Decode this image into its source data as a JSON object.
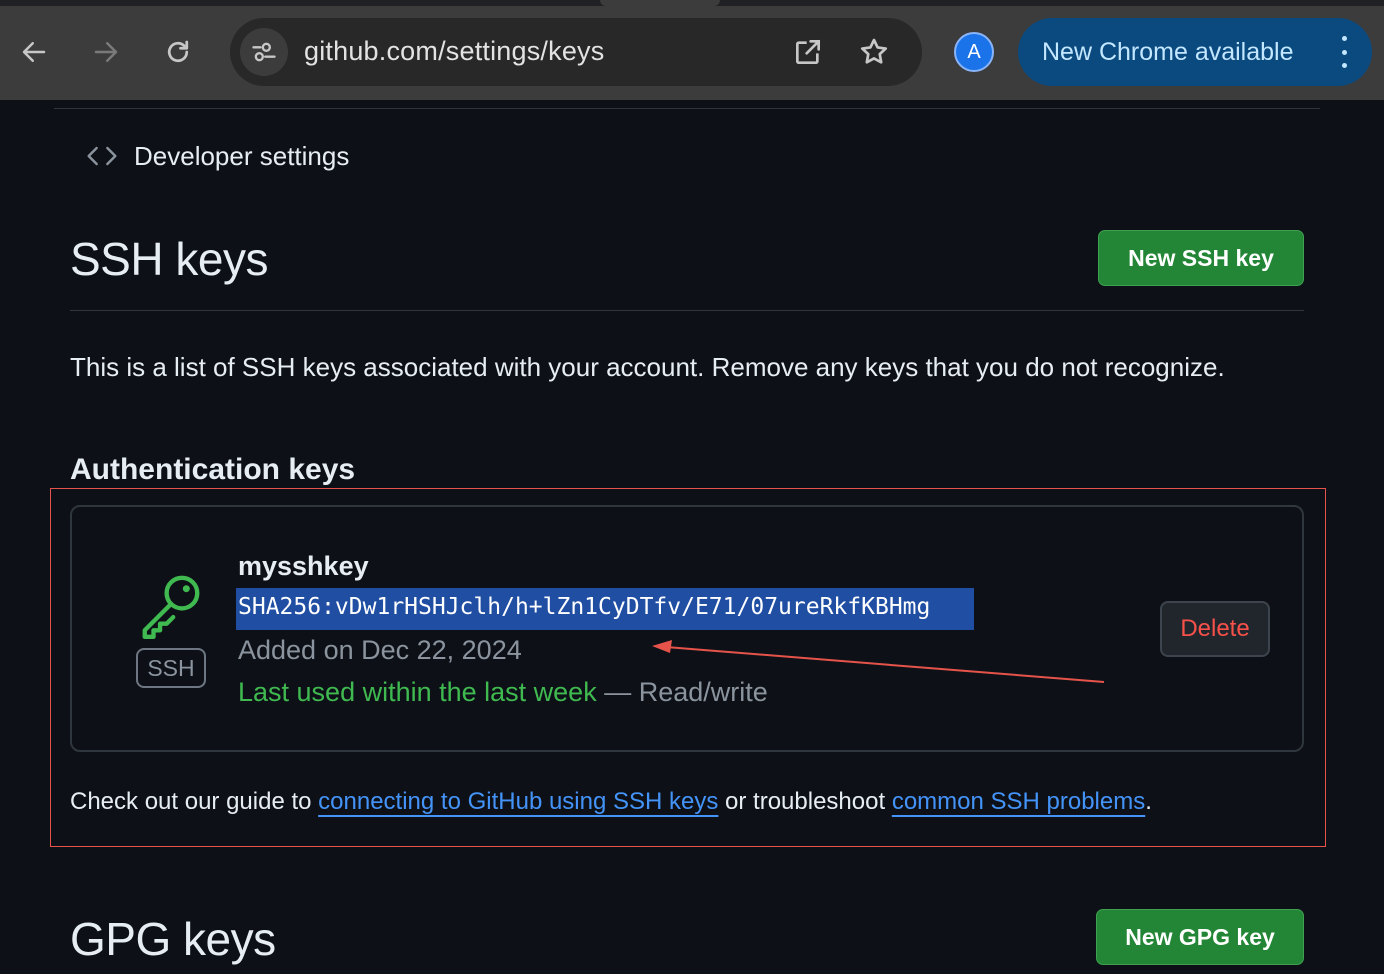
{
  "browser": {
    "url": "github.com/settings/keys",
    "profile_initial": "A",
    "update_label": "New Chrome available"
  },
  "page": {
    "breadcrumb": "Developer settings",
    "ssh": {
      "title": "SSH keys",
      "new_button": "New SSH key",
      "description": "This is a list of SSH keys associated with your account. Remove any keys that you do not recognize.",
      "auth_heading": "Authentication keys",
      "keys": [
        {
          "name": "mysshkey",
          "badge": "SSH",
          "fingerprint": "SHA256:vDw1rHSHJclh/h+lZn1CyDTfv/E71/07ureRkfKBHmg",
          "added": "Added on Dec 22, 2024",
          "last_used": "Last used within the last week",
          "access": " — Read/write",
          "delete_label": "Delete"
        }
      ],
      "guide_prefix": "Check out our guide to ",
      "guide_link1": "connecting to GitHub using SSH keys",
      "guide_middle": " or troubleshoot ",
      "guide_link2": "common SSH problems",
      "guide_suffix": "."
    },
    "gpg": {
      "title": "GPG keys",
      "new_button": "New GPG key"
    }
  },
  "colors": {
    "page_bg": "#0d1117",
    "primary_button": "#238636",
    "danger_text": "#f85149",
    "link": "#4493f8",
    "selection": "#1f4ea3",
    "annotation": "#e5534b"
  }
}
